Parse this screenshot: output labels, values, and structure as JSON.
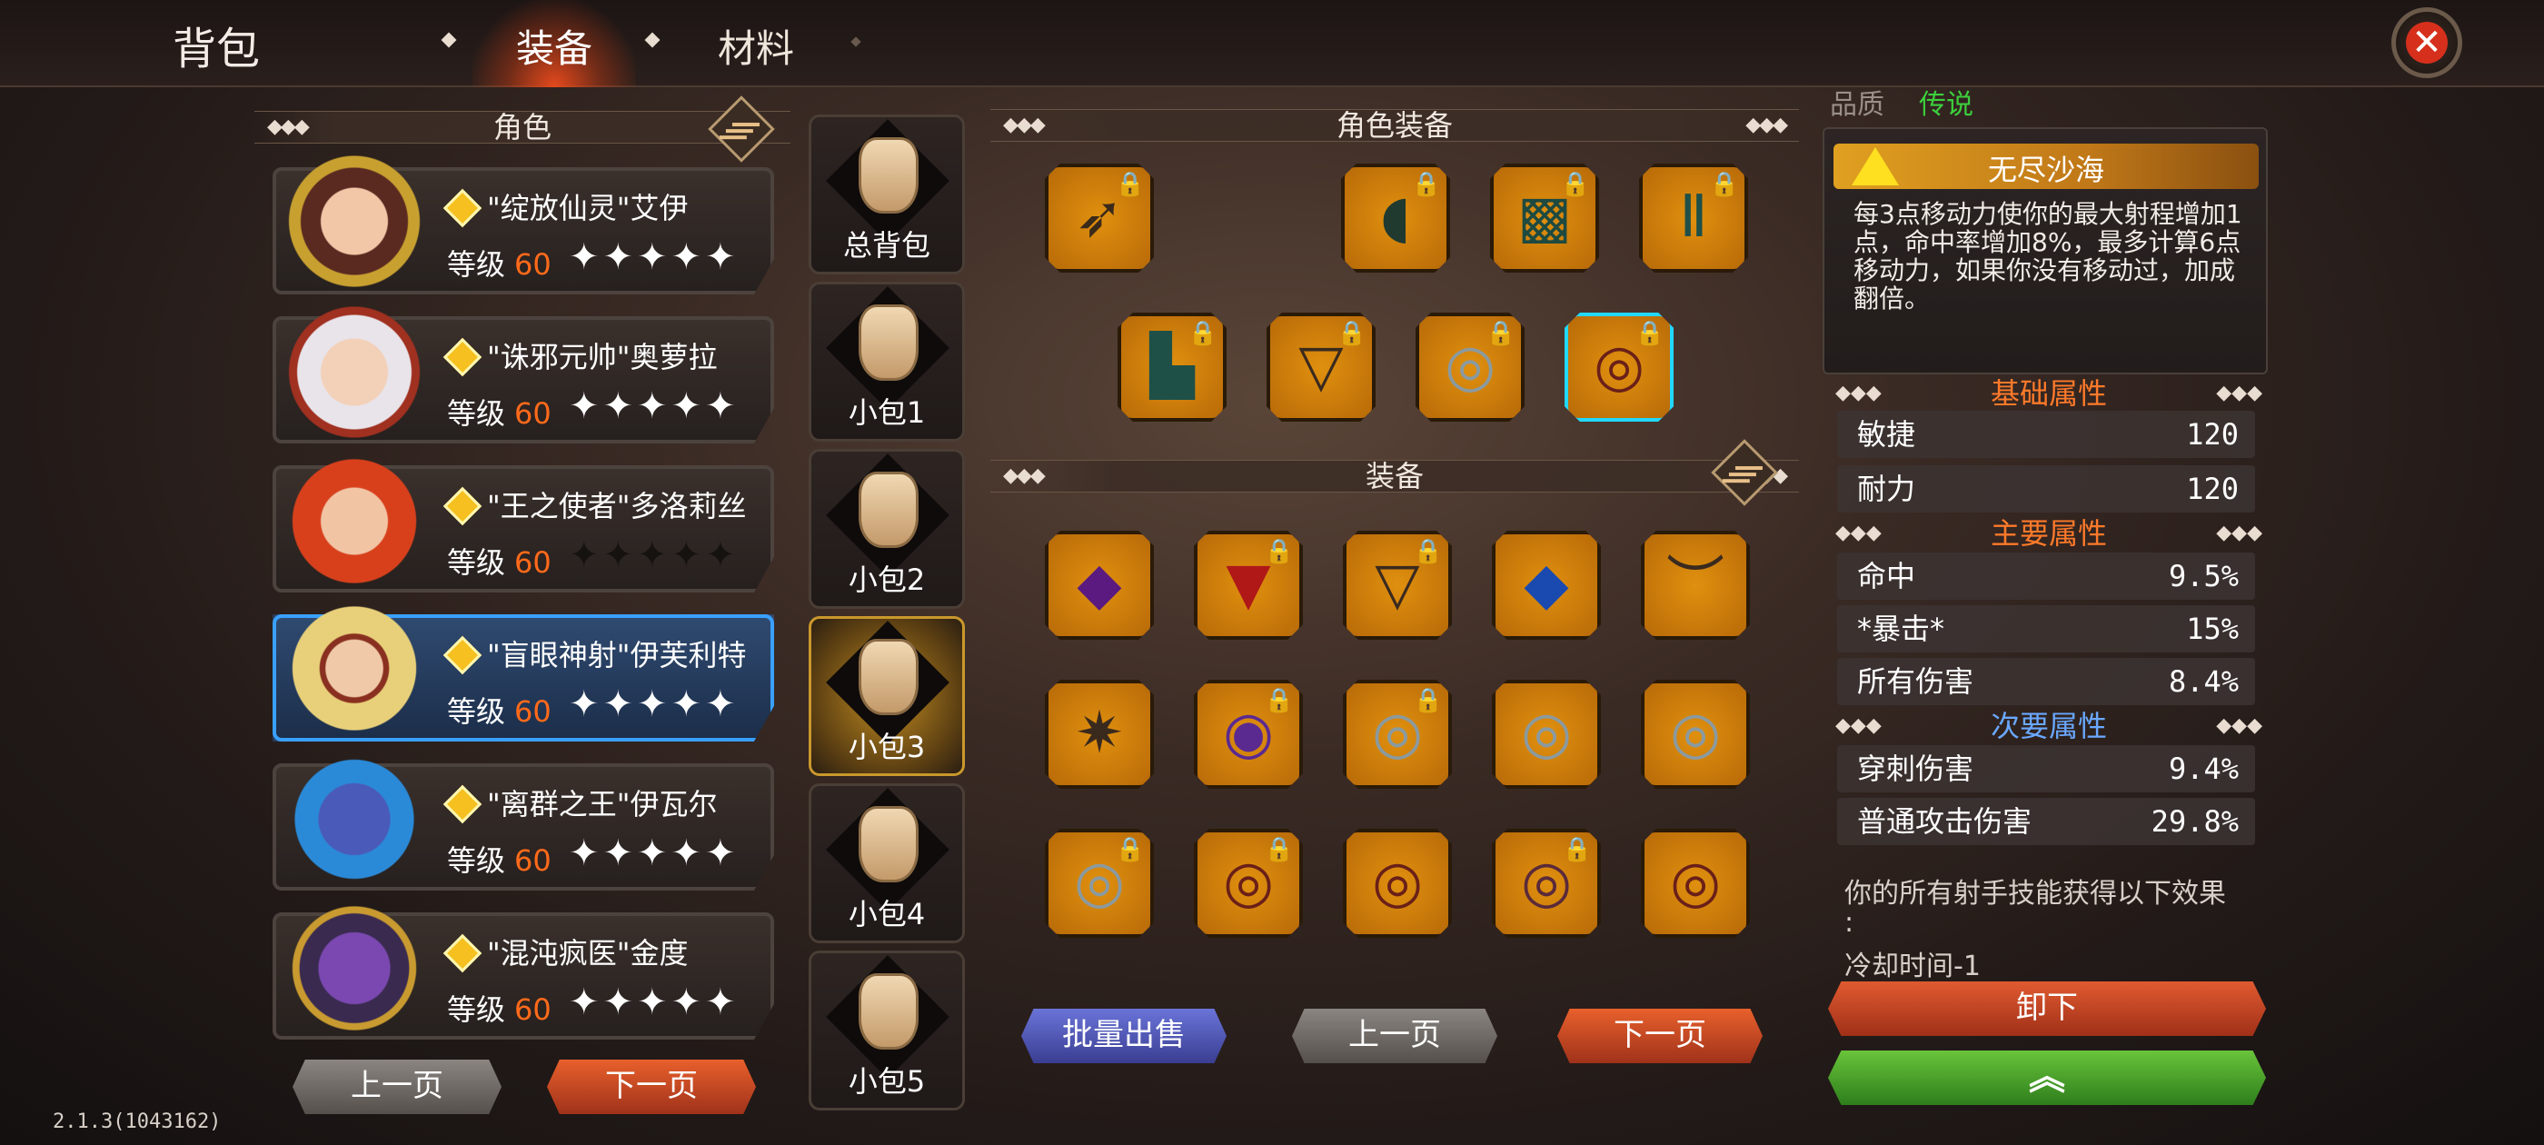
{
  "header": {
    "title": "背包",
    "tabs": [
      "装备",
      "材料"
    ],
    "close_icon": "close-icon"
  },
  "version": "2.1.3(1043162)",
  "roles": {
    "section_title": "角色",
    "list": [
      {
        "name": "\"绽放仙灵\"艾伊",
        "level_label": "等级",
        "level": "60",
        "stars": "✦✦✦✦✦",
        "stars_count": 5
      },
      {
        "name": "\"诛邪元帅\"奥萝拉",
        "level_label": "等级",
        "level": "60",
        "stars": "✦✦✦✦✦",
        "stars_count": 5
      },
      {
        "name": "\"王之使者\"多洛莉丝",
        "level_label": "等级",
        "level": "60",
        "stars": "✦✦✦✦✦",
        "stars_count": 0
      },
      {
        "name": "\"盲眼神射\"伊芙利特",
        "level_label": "等级",
        "level": "60",
        "stars": "✦✦✦✦✦",
        "stars_count": 5,
        "selected": true
      },
      {
        "name": "\"离群之王\"伊瓦尔",
        "level_label": "等级",
        "level": "60",
        "stars": "✦✦✦✦✦",
        "stars_count": 5
      },
      {
        "name": "\"混沌疯医\"金度",
        "level_label": "等级",
        "level": "60",
        "stars": "✦✦✦✦✦",
        "stars_count": 5
      }
    ],
    "prev": "上一页",
    "next": "下一页"
  },
  "bags": [
    {
      "label": "总背包"
    },
    {
      "label": "小包1"
    },
    {
      "label": "小包2"
    },
    {
      "label": "小包3",
      "selected": true
    },
    {
      "label": "小包4"
    },
    {
      "label": "小包5"
    }
  ],
  "equipped": {
    "section_title": "角色装备"
  },
  "inventory": {
    "section_title": "装备",
    "bulk_sell": "批量出售",
    "prev": "上一页",
    "next": "下一页"
  },
  "detail": {
    "quality_label": "品质",
    "quality_value": "传说",
    "item_name": "无尽沙海",
    "description": "每3点移动力使你的最大射程增加1点，命中率增加8%，最多计算6点移动力，如果你没有移动过，加成翻倍。",
    "basic": {
      "title": "基础属性",
      "rows": [
        {
          "k": "敏捷",
          "v": "120"
        },
        {
          "k": "耐力",
          "v": "120"
        }
      ]
    },
    "main": {
      "title": "主要属性",
      "rows": [
        {
          "k": "命中",
          "v": "9.5%"
        },
        {
          "k": "*暴击*",
          "v": "15%"
        },
        {
          "k": "所有伤害",
          "v": "8.4%"
        }
      ]
    },
    "secondary": {
      "title": "次要属性",
      "rows": [
        {
          "k": "穿刺伤害",
          "v": "9.4%"
        },
        {
          "k": "普通攻击伤害",
          "v": "29.8%"
        }
      ]
    },
    "effect_line1": "你的所有射手技能获得以下效果",
    "effect_line2": ":",
    "effect_line3": "冷却时间-1",
    "unequip": "卸下",
    "upgrade_icon": "chevron-up-icon"
  },
  "colors": {
    "accent_orange": "#ff6a1a",
    "basic_title": "#ff7a2a",
    "main_title": "#ff7a2a",
    "secondary_title": "#6aa8ff",
    "quality_green": "#3ccf3c"
  }
}
